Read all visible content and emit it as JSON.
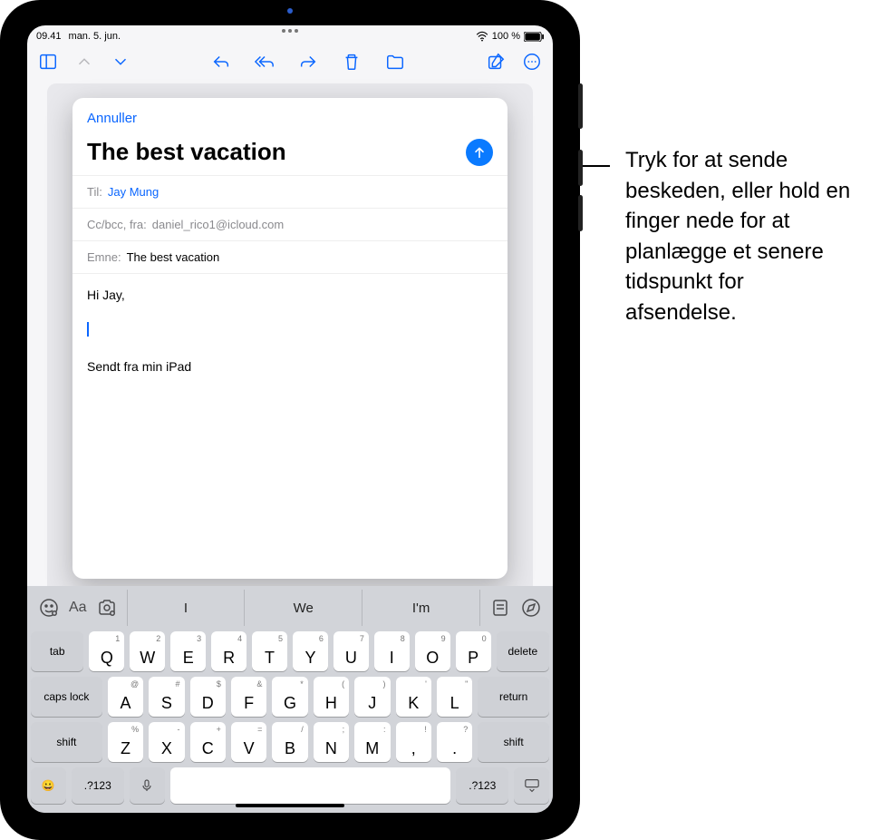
{
  "status": {
    "time": "09.41",
    "date": "man. 5. jun.",
    "battery": "100 %"
  },
  "toolbar": {
    "sidebar": "sidebar-icon",
    "up": "chevron-up-icon",
    "down": "chevron-down-icon",
    "reply": "reply-icon",
    "replyAll": "reply-all-icon",
    "forward": "forward-icon",
    "trash": "trash-icon",
    "move": "folder-icon",
    "compose": "compose-icon",
    "more": "more-icon"
  },
  "compose": {
    "cancel": "Annuller",
    "title": "The best vacation",
    "to": {
      "label": "Til:",
      "value": "Jay Mung"
    },
    "cc": {
      "label": "Cc/bcc, fra:",
      "value": "daniel_rico1@icloud.com"
    },
    "subject": {
      "label": "Emne:",
      "value": "The best vacation"
    },
    "body_greeting": "Hi Jay,",
    "signature": "Sendt fra min iPad"
  },
  "keyboard": {
    "pred": [
      "I",
      "We",
      "I'm"
    ],
    "row1": [
      [
        "Q",
        "1"
      ],
      [
        "W",
        "2"
      ],
      [
        "E",
        "3"
      ],
      [
        "R",
        "4"
      ],
      [
        "T",
        "5"
      ],
      [
        "Y",
        "6"
      ],
      [
        "U",
        "7"
      ],
      [
        "I",
        "8"
      ],
      [
        "O",
        "9"
      ],
      [
        "P",
        "0"
      ]
    ],
    "row2": [
      [
        "A",
        "@"
      ],
      [
        "S",
        "#"
      ],
      [
        "D",
        "$"
      ],
      [
        "F",
        "&"
      ],
      [
        "G",
        "*"
      ],
      [
        "H",
        "("
      ],
      [
        "J",
        ")"
      ],
      [
        "K",
        "'"
      ],
      [
        "L",
        "\""
      ]
    ],
    "row3": [
      [
        "Z",
        "%"
      ],
      [
        "X",
        "-"
      ],
      [
        "C",
        "+"
      ],
      [
        "V",
        "="
      ],
      [
        "B",
        "/"
      ],
      [
        "N",
        ";"
      ],
      [
        "M",
        ":"
      ],
      [
        ",",
        "!"
      ],
      [
        ".",
        "?"
      ]
    ],
    "tab": "tab",
    "del": "delete",
    "caps": "caps lock",
    "ret": "return",
    "shift": "shift",
    "emoji": "😀",
    "numA": ".?123",
    "mic": "🎤",
    "numB": ".?123"
  },
  "callout": "Tryk for at sende beskeden, eller hold en finger nede for at planlægge et senere tidspunkt for afsendelse."
}
